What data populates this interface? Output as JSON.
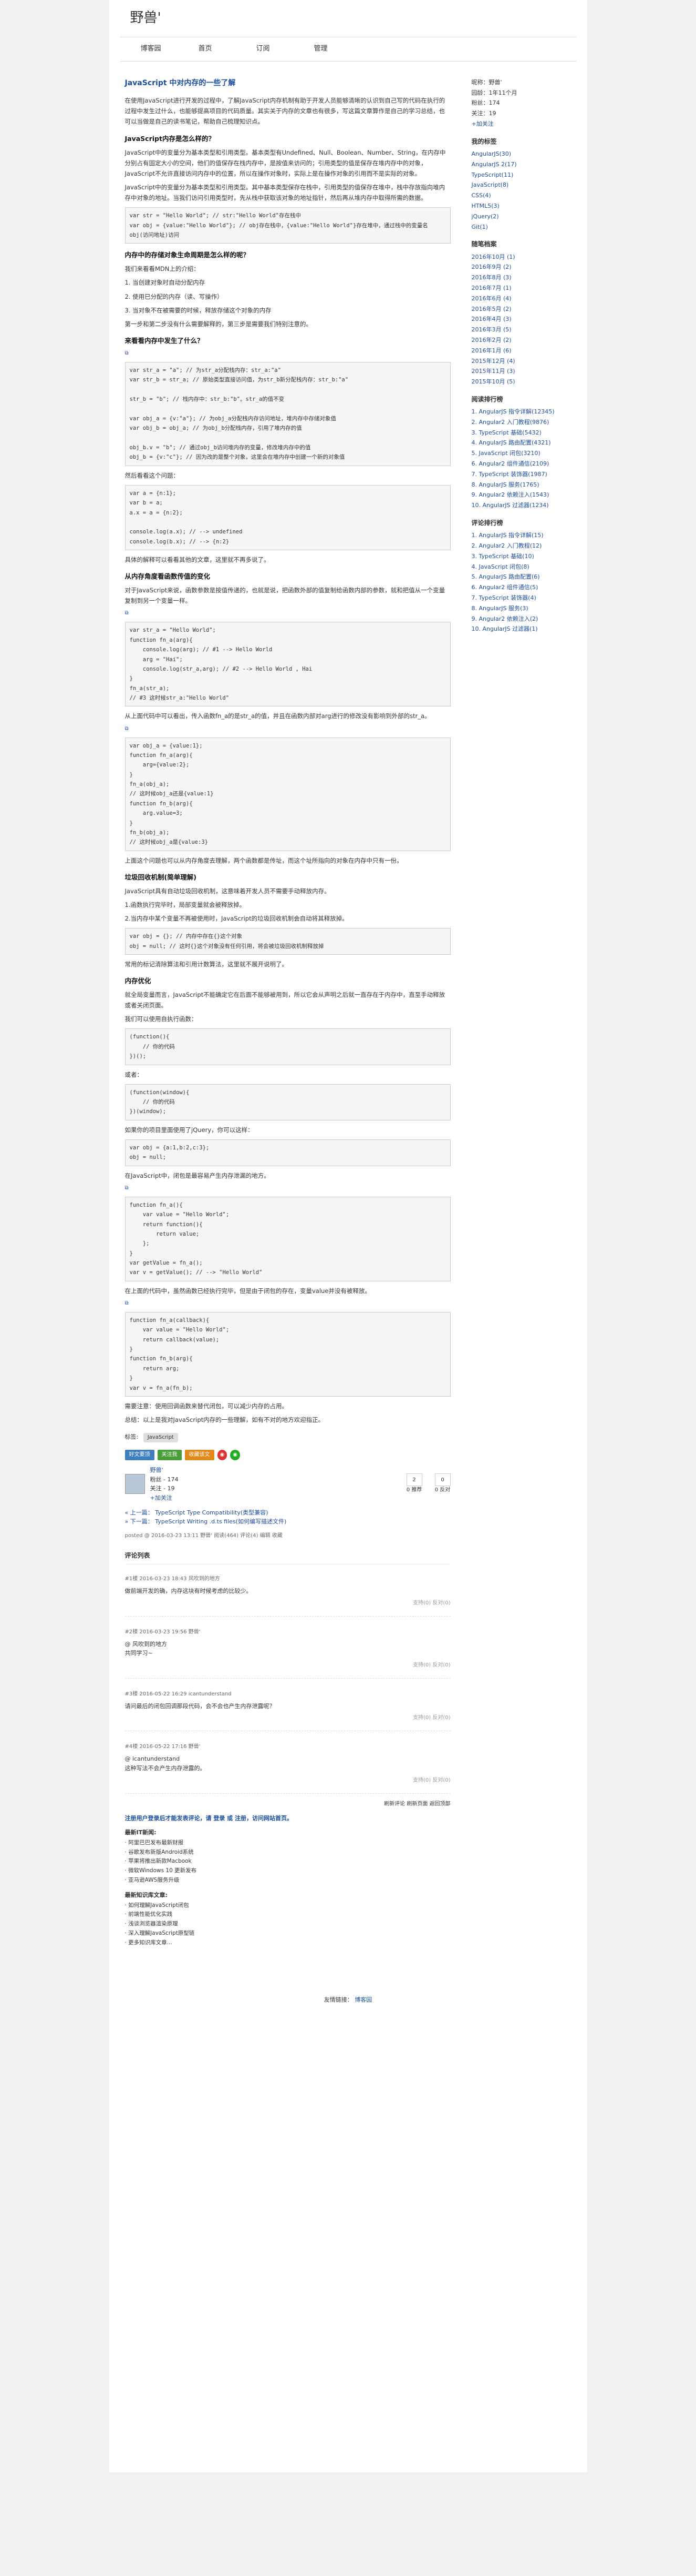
{
  "header": {
    "logo": "野兽'"
  },
  "nav": [
    "博客园",
    "首页",
    "订阅",
    "管理"
  ],
  "article": {
    "title": "JavaScript 中对内存的一些了解",
    "intro": "在使用JavaScript进行开发的过程中，了解JavaScript内存机制有助于开发人员能够清晰的认识到自己写的代码在执行的过程中发生过什么，也能够提高项目的代码质量。其实关于内存的文章也有很多，写这篇文章算作是自己的学习总结，也可以当做是自己的读书笔记，帮助自己梳理知识点。",
    "h_types": "JavaScript内存是怎么样的？",
    "p_types1": "JavaScript中的变量分为基本类型和引用类型。基本类型有Undefined、Null、Boolean、Number、String，在内存中分别占有固定大小的空间，他们的值保存在栈内存中，是按值来访问的；引用类型的值是保存在堆内存中的对象，JavaScript不允许直接访问内存中的位置，所以在操作对象时，实际上是在操作对象的引用而不是实际的对象。",
    "p_types2": "JavaScript中的变量分为基本类型和引用类型。其中基本类型保存在栈中，引用类型的值保存在堆中，栈中存放指向堆内存中对象的地址。当我们访问引用类型时，先从栈中获取该对象的地址指针，然后再从堆内存中取得所需的数据。",
    "code1": "var str = \"Hello World\"; // str:\"Hello World\"存在栈中\nvar obj = {value:\"Hello World\"}; // obj存在栈中，{value:\"Hello World\"}存在堆中，通过栈中的变量名obj(访问地址)访问",
    "h_lifecycle": "内存中的存储对象生命周期是怎么样的呢？",
    "p_lifecycle": "我们来看看MDN上的介绍：",
    "lifecycle": [
      "1. 当创建对象时自动分配内存",
      "2. 使用已分配的内存（读、写操作）",
      "3. 当对象不在被需要的时候，释放存储这个对象的内存"
    ],
    "p_lifecycle2": "第一步和第二步没有什么需要解释的，第三步是需要我们特别注意的。",
    "h_change": "来看看内存中发生了什么？",
    "code2": "var str_a = \"a\"; // 为str_a分配栈内存：str_a:\"a\"\nvar str_b = str_a; // 原始类型直接访问值，为str_b新分配栈内存：str_b:\"a\"\n\nstr_b = \"b\"; // 栈内存中：str_b:\"b\"。str_a的值不变\n\nvar obj_a = {v:\"a\"}; // 为obj_a分配栈内存访问地址，堆内存中存储对象值\nvar obj_b = obj_a; // 为obj_b分配栈内存，引用了堆内存的值\n\nobj_b.v = \"b\"; // 通过obj_b访问堆内存的变量，修改堆内存中的值\nobj_b = {v:\"c\"}; // 因为改的是整个对象，这里会在堆内存中创建一个新的对象值",
    "p_continue": "然后看看这个问题：",
    "code3": "var a = {n:1};\nvar b = a;\na.x = a = {n:2};\n\nconsole.log(a.x); // --> undefined\nconsole.log(b.x); // --> {n:2}",
    "p_continue2": "具体的解释可以看看其他的文章，这里就不再多说了。",
    "h_gc": "从内存角度看函数传值的变化",
    "p_gc1": "对于JavaScript来说，函数参数是按值传递的，也就是说，把函数外部的值复制给函数内部的参数，就和把值从一个变量复制到另一个变量一样。",
    "code4": "var str_a = \"Hello World\";\nfunction fn_a(arg){\n    console.log(arg); // #1 --> Hello World\n    arg = \"Hai\";\n    console.log(str_a,arg); // #2 --> Hello World , Hai\n}\nfn_a(str_a);\n// #3 这时候str_a:\"Hello World\"",
    "p_gc2": "从上面代码中可以看出，传入函数fn_a的是str_a的值，并且在函数内部对arg进行的修改没有影响到外部的str_a。",
    "code5": "var obj_a = {value:1};\nfunction fn_a(arg){\n    arg={value:2};\n}\nfn_a(obj_a);\n// 这时候obj_a还是{value:1}\nfunction fn_b(arg){\n    arg.value=3;\n}\nfn_b(obj_a);\n// 这时候obj_a是{value:3}",
    "p_gc3": "上面这个问题也可以从内存角度去理解，两个函数都是传址，而这个址所指向的对象在内存中只有一份。",
    "h_gc2": "垃圾回收机制(简单理解)",
    "p_gc4": "JavaScript具有自动垃圾回收机制，这意味着开发人员不需要手动释放内存。",
    "p_gc5": "1.函数执行完毕时，局部变量就会被释放掉。",
    "p_gc6": "2.当内存中某个变量不再被使用时，JavaScript的垃圾回收机制会自动将其释放掉。",
    "code6": "var obj = {}; // 内存中存在{}这个对象\nobj = null; // 这时{}这个对象没有任何引用，将会被垃圾回收机制释放掉",
    "p_gc7": "常用的标记清除算法和引用计数算法，这里就不展开说明了。",
    "h_leak": "内存优化",
    "p_leak1": "就全局变量而言，JavaScript不能确定它在后面不能够被用到，所以它会从声明之后就一直存在于内存中，直至手动释放或者关闭页面。",
    "p_leak2": "我们可以使用自执行函数：",
    "code7": "(function(){\n    // 你的代码\n})();",
    "p_leak3": "或者：",
    "code8": "(function(window){\n    // 你的代码\n})(window);",
    "p_leak4": "如果你的项目里面使用了jQuery，你可以这样：",
    "code9": "var obj = {a:1,b:2,c:3};\nobj = null;",
    "p_leak5": "在JavaScript中，闭包是最容易产生内存泄漏的地方。",
    "code10": "function fn_a(){\n    var value = \"Hello World\";\n    return function(){\n        return value;\n    };\n}\nvar getValue = fn_a();\nvar v = getValue(); // --> \"Hello World\"",
    "p_leak6": "在上面的代码中，虽然函数已经执行完毕，但是由于闭包的存在，变量value并没有被释放。",
    "code11": "function fn_a(callback){\n    var value = \"Hello World\";\n    return callback(value);\n}\nfunction fn_b(arg){\n    return arg;\n}\nvar v = fn_a(fn_b);",
    "p_end1": "需要注意：使用回调函数来替代闭包，可以减少内存的占用。",
    "p_end2": "总结：以上是我对JavaScript内存的一些理解，如有不对的地方欢迎指正。"
  },
  "tags": {
    "label": "标签:",
    "items": [
      "JavaScript"
    ]
  },
  "share": [
    "好文要顶",
    "关注我",
    "收藏该文"
  ],
  "author": {
    "name": "野兽'",
    "fans": "粉丝 - 174",
    "follow": "关注 - 19",
    "plus": "+加关注"
  },
  "votes": [
    {
      "count": "2",
      "label": "0 推荐"
    },
    {
      "count": "0",
      "label": "0 反对"
    }
  ],
  "postnav": [
    "« 上一篇： TypeScript Type Compatibility(类型兼容)",
    "» 下一篇： TypeScript Writing .d.ts files(如何编写描述文件)"
  ],
  "postinfo": "posted @ 2016-03-23 13:11 野兽' 阅读(464) 评论(4) 编辑 收藏",
  "comments_title": "评论列表",
  "comments": [
    {
      "meta": "#1楼 2016-03-23 18:43 风吹到的地方",
      "body": "做前端开发的确，内存这块有时候考虑的比较少。",
      "act": "支持(0) 反对(0)"
    },
    {
      "meta": "#2楼 2016-03-23 19:56 野兽'",
      "body": "@ 风吹到的地方\n共同学习~",
      "act": "支持(0) 反对(0)"
    },
    {
      "meta": "#3楼 2016-05-22 16:29 icantunderstand",
      "body": "请问最后的闭包回调那段代码，会不会也产生内存泄露呢？",
      "act": "支持(0) 反对(0)"
    },
    {
      "meta": "#4楼 2016-05-22 17:16 野兽'",
      "body": "@ icantunderstand\n这种写法不会产生内存泄露的。",
      "act": "支持(0) 反对(0)"
    }
  ],
  "refresh": "刷新评论 刷新页面 返回顶部",
  "notice": "注册用户登录后才能发表评论，请 登录 或 注册，访问网站首页。",
  "news": {
    "h1": "最新IT新闻:",
    "items1": [
      "· 阿里巴巴发布最新财报",
      "· 谷歌发布新版Android系统",
      "· 苹果将推出新款Macbook",
      "· 微软Windows 10 更新发布",
      "· 亚马逊AWS服务升级"
    ],
    "h2": "最新知识库文章:",
    "items2": [
      "· 如何理解JavaScript闭包",
      "· 前端性能优化实践",
      "· 浅谈浏览器渲染原理",
      "· 深入理解JavaScript原型链",
      "· 更多知识库文章..."
    ]
  },
  "side": {
    "nick": "昵称：野兽'",
    "age": "园龄：1年11个月",
    "fans": "粉丝：174",
    "follow": "关注：19",
    "plus": "+加关注",
    "h_cat": "我的标签",
    "cats": [
      "AngularJS(30)",
      "AngularJS 2(17)",
      "TypeScript(11)",
      "JavaScript(8)",
      "CSS(4)",
      "HTML5(3)",
      "jQuery(2)",
      "Git(1)"
    ],
    "h_arch": "随笔档案",
    "archives": [
      "2016年10月 (1)",
      "2016年9月 (2)",
      "2016年8月 (3)",
      "2016年7月 (1)",
      "2016年6月 (4)",
      "2016年5月 (2)",
      "2016年4月 (3)",
      "2016年3月 (5)",
      "2016年2月 (2)",
      "2016年1月 (6)",
      "2015年12月 (4)",
      "2015年11月 (3)",
      "2015年10月 (5)"
    ],
    "h_read": "阅读排行榜",
    "reads": [
      "1. AngularJS 指令详解(12345)",
      "2. Angular2 入门教程(9876)",
      "3. TypeScript 基础(5432)",
      "4. AngularJS 路由配置(4321)",
      "5. JavaScript 闭包(3210)",
      "6. Angular2 组件通信(2109)",
      "7. TypeScript 装饰器(1987)",
      "8. AngularJS 服务(1765)",
      "9. Angular2 依赖注入(1543)",
      "10. AngularJS 过滤器(1234)"
    ],
    "h_comment": "评论排行榜",
    "commentsTop": [
      "1. AngularJS 指令详解(15)",
      "2. Angular2 入门教程(12)",
      "3. TypeScript 基础(10)",
      "4. JavaScript 闭包(8)",
      "5. AngularJS 路由配置(6)",
      "6. Angular2 组件通信(5)",
      "7. TypeScript 装饰器(4)",
      "8. AngularJS 服务(3)",
      "9. Angular2 依赖注入(2)",
      "10. AngularJS 过滤器(1)"
    ]
  },
  "footer": {
    "label": "友情链接：",
    "link": "博客园"
  }
}
